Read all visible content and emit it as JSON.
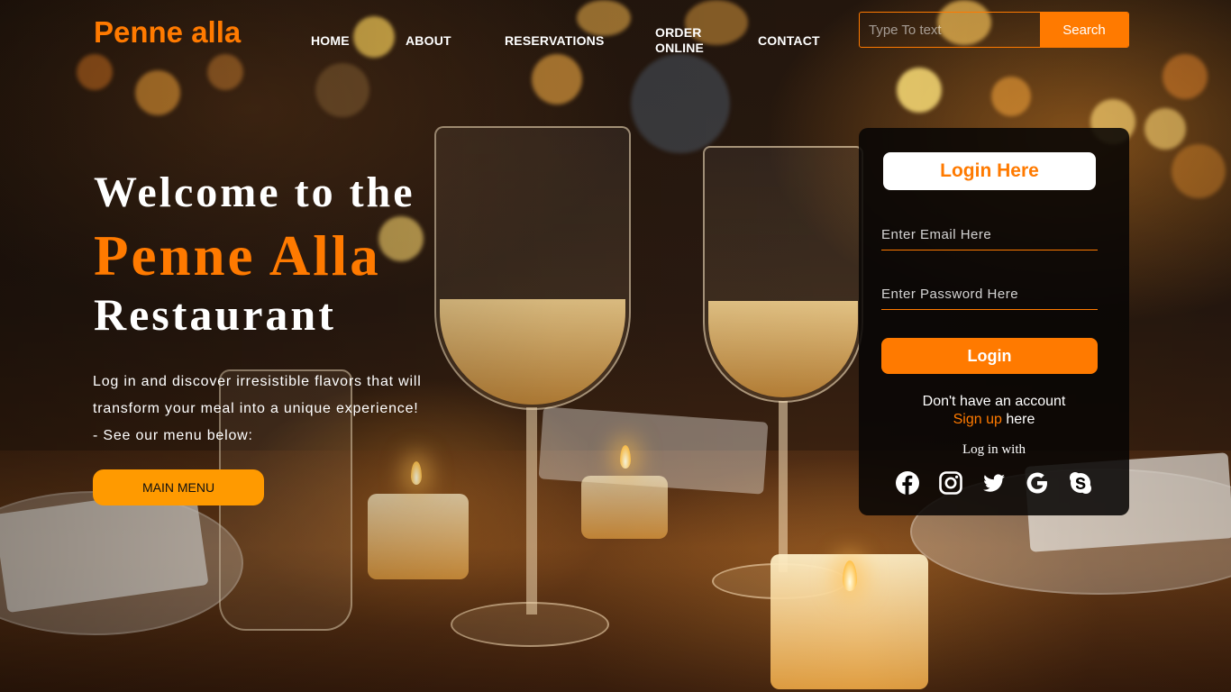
{
  "brand": {
    "name": "Penne alla",
    "color": "#ff7a00"
  },
  "nav": {
    "items": [
      {
        "label": "HOME"
      },
      {
        "label": "ABOUT"
      },
      {
        "label": "RESERVATIONS"
      },
      {
        "label": "ORDER\nONLINE"
      },
      {
        "label": "CONTACT"
      }
    ]
  },
  "search": {
    "placeholder": "Type To text",
    "button_label": "Search"
  },
  "hero": {
    "line1": "Welcome to the",
    "line2": "Penne Alla",
    "line3": "Restaurant",
    "description": [
      "Log in and discover irresistible flavors that will",
      "transform your meal into a unique experience!",
      "- See our menu below:"
    ],
    "button_label": "MAIN MENU"
  },
  "login": {
    "title": "Login Here",
    "email_placeholder": "Enter Email Here",
    "password_placeholder": "Enter Password Here",
    "button_label": "Login",
    "no_account_text": "Don't have an account",
    "signup_link": "Sign up",
    "signup_suffix": " here",
    "login_with": "Log in with",
    "socials": [
      "facebook-icon",
      "instagram-icon",
      "twitter-icon",
      "google-icon",
      "skype-icon"
    ]
  },
  "colors": {
    "accent": "#ff7a00",
    "accent_light": "#ff9a00",
    "card_bg": "#080605"
  }
}
